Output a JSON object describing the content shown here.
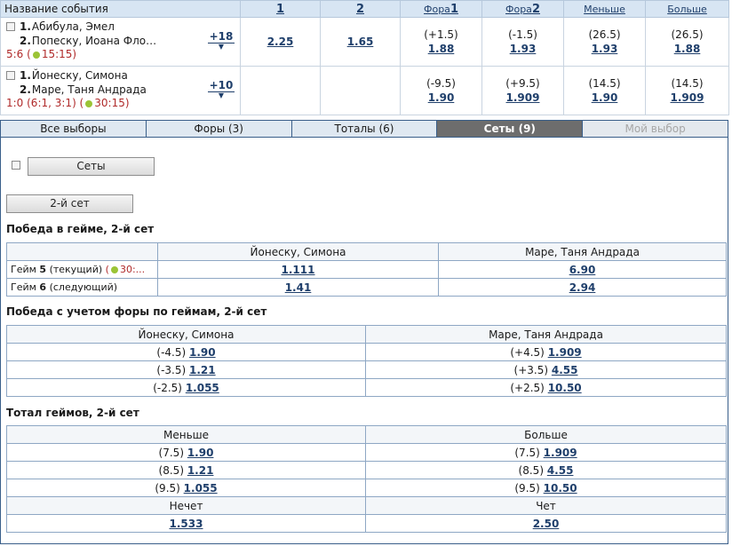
{
  "header": {
    "name_col": "Название события",
    "col1": "1",
    "col2": "2",
    "fora1_prefix": "Фора",
    "fora1_num": "1",
    "fora2_prefix": "Фора",
    "fora2_num": "2",
    "less": "Меньше",
    "more": "Больше"
  },
  "events": [
    {
      "p1_num": "1.",
      "p1": "Абибула, Эмел",
      "p2_num": "2.",
      "p2": "Попеску, Иоана Фло…",
      "score_a": "5:6 (",
      "score_b": "15:15)",
      "more": "+18",
      "w1": "2.25",
      "w2": "1.65",
      "f1_cond": "(+1.5)",
      "f1_odd": "1.88",
      "f2_cond": "(-1.5)",
      "f2_odd": "1.93",
      "u_cond": "(26.5)",
      "u_odd": "1.93",
      "o_cond": "(26.5)",
      "o_odd": "1.88"
    },
    {
      "p1_num": "1.",
      "p1": "Йонеску, Симона",
      "p2_num": "2.",
      "p2": "Маре, Таня Андрада",
      "score_a": "1:0 (6:1, 3:1) (",
      "score_b": "30:15)",
      "more": "+10",
      "w1": "",
      "w2": "",
      "f1_cond": "(-9.5)",
      "f1_odd": "1.90",
      "f2_cond": "(+9.5)",
      "f2_odd": "1.909",
      "u_cond": "(14.5)",
      "u_odd": "1.90",
      "o_cond": "(14.5)",
      "o_odd": "1.909"
    }
  ],
  "tabs": [
    "Все выборы",
    "Форы (3)",
    "Тоталы (6)",
    "Сеты (9)",
    "Мой выбор"
  ],
  "panel": {
    "sets_button": "Сеты",
    "set2_button": "2-й сет",
    "game_win": {
      "title": "Победа в гейме, 2-й сет",
      "p1": "Йонеску, Симона",
      "p2": "Маре, Таня Андрада",
      "rows": [
        {
          "label_a": "Гейм ",
          "label_num": "5",
          "label_b": " (текущий)",
          "timer": "30:...",
          "o1": "1.111",
          "o2": "6.90"
        },
        {
          "label_a": "Гейм ",
          "label_num": "6",
          "label_b": " (следующий)",
          "timer": "",
          "o1": "1.41",
          "o2": "2.94"
        }
      ]
    },
    "handicap": {
      "title": "Победа с учетом форы по геймам, 2-й сет",
      "p1": "Йонеску, Симона",
      "p2": "Маре, Таня Андрада",
      "rows": [
        {
          "c1": "(-4.5)",
          "o1": "1.90",
          "c2": "(+4.5)",
          "o2": "1.909"
        },
        {
          "c1": "(-3.5)",
          "o1": "1.21",
          "c2": "(+3.5)",
          "o2": "4.55"
        },
        {
          "c1": "(-2.5)",
          "o1": "1.055",
          "c2": "(+2.5)",
          "o2": "10.50"
        }
      ]
    },
    "total": {
      "title": "Тотал геймов, 2-й сет",
      "h1": "Меньше",
      "h2": "Больше",
      "rows": [
        {
          "c1": "(7.5)",
          "o1": "1.90",
          "c2": "(7.5)",
          "o2": "1.909"
        },
        {
          "c1": "(8.5)",
          "o1": "1.21",
          "c2": "(8.5)",
          "o2": "4.55"
        },
        {
          "c1": "(9.5)",
          "o1": "1.055",
          "c2": "(9.5)",
          "o2": "10.50"
        }
      ],
      "odd_label": "Нечет",
      "even_label": "Чет",
      "odd_value": "1.533",
      "even_value": "2.50"
    }
  },
  "colors": {
    "accent": "#1f3f6b",
    "header_bg": "#d7e5f3",
    "score": "#b02a2a",
    "active_tab": "#6d6d6d"
  }
}
